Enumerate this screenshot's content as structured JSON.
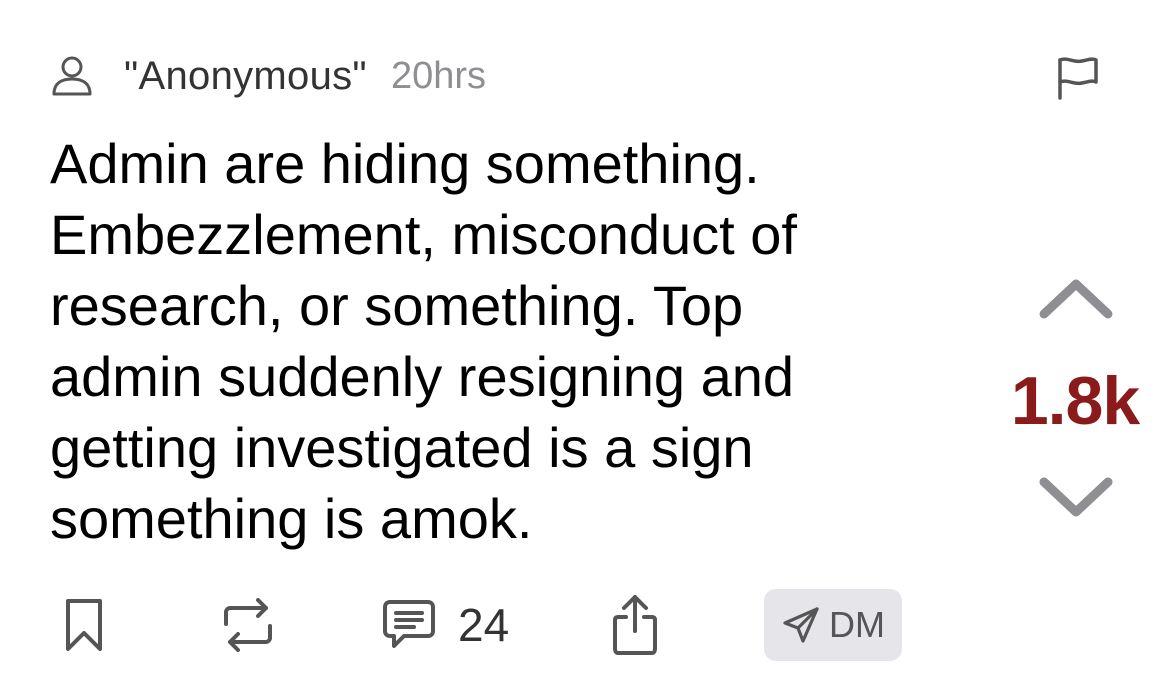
{
  "post": {
    "author": "\"Anonymous\"",
    "time": "20hrs",
    "text_lines": [
      "Admin are hiding something.",
      "Embezzlement, misconduct of",
      "research, or something. Top",
      "admin suddenly resigning and",
      "getting investigated is a sign",
      "something is amok."
    ]
  },
  "vote": {
    "score": "1.8k",
    "score_color": "#8b1a1a"
  },
  "actions": {
    "comment_count": "24",
    "dm_label": "DM"
  },
  "icons": {
    "user": "user-icon",
    "flag": "flag-icon",
    "upvote": "chevron-up-icon",
    "downvote": "chevron-down-icon",
    "bookmark": "bookmark-icon",
    "repost": "repost-icon",
    "comment": "comment-icon",
    "share": "share-icon",
    "send": "send-icon"
  },
  "colors": {
    "icon_gray": "#555555",
    "arrow_gray": "#8e8e93",
    "dm_bg": "#e5e5ea",
    "muted_text": "#8e8e93"
  }
}
